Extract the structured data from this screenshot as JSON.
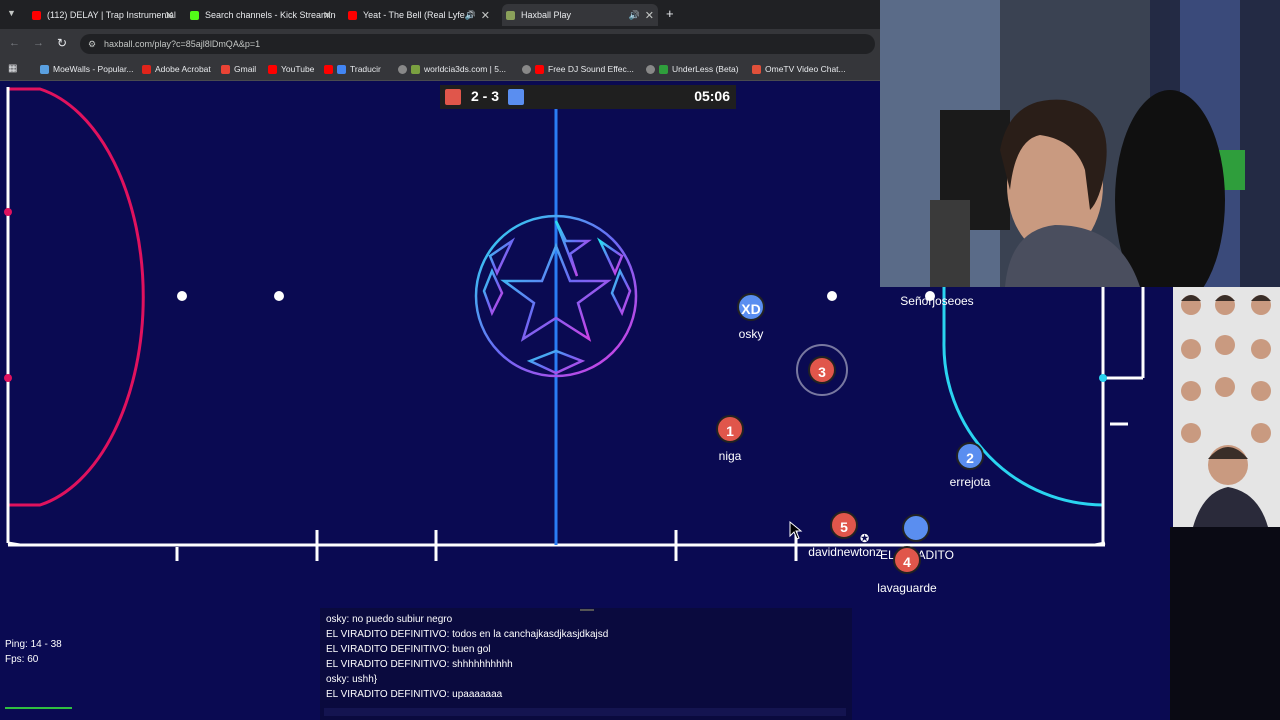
{
  "browser": {
    "tabs": [
      {
        "title": "(112) DELAY | Trap Instrumental",
        "icon_color": "#ff0000"
      },
      {
        "title": "Search channels - Kick Streaming",
        "icon_color": "#53fc18"
      },
      {
        "title": "Yeat - The Bell (Real Lyfe Sh",
        "icon_color": "#ff0000"
      },
      {
        "title": "Haxball Play",
        "icon_color": "#8aa05a"
      }
    ],
    "url": "haxball.com/play?c=85ajl8lDmQA&p=1",
    "bookmarks": [
      {
        "label": "MoeWalls - Popular..."
      },
      {
        "label": "Adobe Acrobat"
      },
      {
        "label": "Gmail"
      },
      {
        "label": "YouTube"
      },
      {
        "label": "Traducir"
      },
      {
        "label": "worldcia3ds.com | 5..."
      },
      {
        "label": "Free DJ Sound Effec..."
      },
      {
        "label": "UnderLess (Beta)"
      },
      {
        "label": "OmeTV Video Chat..."
      }
    ]
  },
  "game": {
    "score": "2 - 3",
    "timer": "05:06",
    "players": [
      {
        "number": "XD",
        "team": "blue",
        "name": "osky"
      },
      {
        "number": "3",
        "team": "red",
        "name": ""
      },
      {
        "number": "1",
        "team": "red",
        "name": "niga"
      },
      {
        "number": "2",
        "team": "blue",
        "name": "errejota"
      },
      {
        "number": "5",
        "team": "red",
        "name": "davidnewtonz"
      },
      {
        "number": "",
        "team": "blue",
        "name": "EL VIRADITO"
      },
      {
        "number": "4",
        "team": "red",
        "name": "lavaguarde"
      }
    ],
    "offscreen_name": "Señorjoseoes",
    "ping": "Ping: 14 - 38",
    "fps": "Fps: 60",
    "colors": {
      "red": "#e0564b",
      "blue": "#5a8ef0",
      "field": "#0a0a52"
    }
  },
  "chat": {
    "messages": [
      "osky: no puedo subiur negro",
      "EL VIRADITO DEFINITIVO: todos en la canchajkasdjkasjdkajsd",
      "EL VIRADITO DEFINITIVO: buen gol",
      "EL VIRADITO DEFINITIVO: shhhhhhhhhh",
      "osky: ushh}",
      "EL VIRADITO DEFINITIVO: upaaaaaaa"
    ]
  }
}
